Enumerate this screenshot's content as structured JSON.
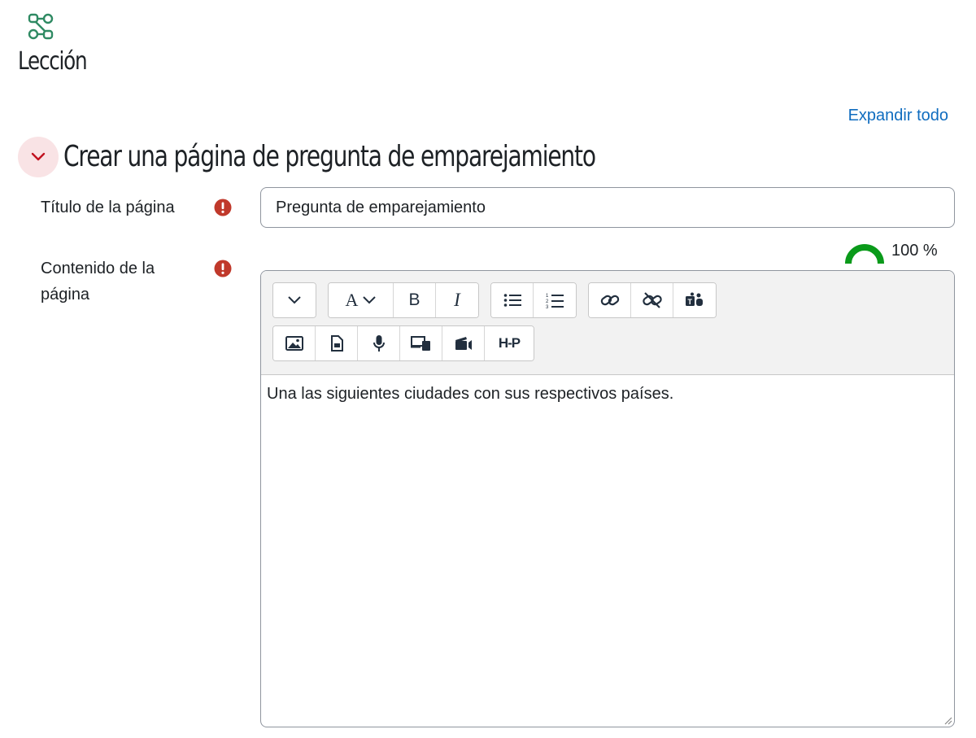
{
  "module": {
    "title": "Lección",
    "icon": "lesson-network-icon",
    "icon_color": "#2f8a63"
  },
  "actions": {
    "expand_all": "Expandir todo"
  },
  "section": {
    "title": "Crear una página de pregunta de emparejamiento",
    "toggle_icon": "chevron-down-icon",
    "toggle_color": "#c1121f"
  },
  "fields": {
    "page_title": {
      "label": "Título de la página",
      "value": "Pregunta de emparejamiento"
    },
    "page_contents": {
      "label_line1": "Contenido de la",
      "label_line2": "página"
    }
  },
  "required_icon_color": "#c0392b",
  "accessibility_gauge": {
    "value_text": "100 %",
    "value": 100,
    "color": "#0a9a1a"
  },
  "toolbar": {
    "row1": [
      [
        "collapse-toolbar-button"
      ],
      [
        "font-style-button",
        "bold-button",
        "italic-button"
      ],
      [
        "bullet-list-button",
        "numbered-list-button"
      ],
      [
        "link-button",
        "unlink-button",
        "teams-meeting-button"
      ]
    ],
    "row2": [
      [
        "image-button",
        "file-button",
        "record-audio-button",
        "record-screen-button",
        "media-button",
        "h5p-button"
      ]
    ],
    "bold_label": "B",
    "italic_label": "I",
    "font_label": "A",
    "h5p_label": "H-P"
  },
  "editor": {
    "content": "Una las siguientes ciudades con sus respectivos países."
  }
}
